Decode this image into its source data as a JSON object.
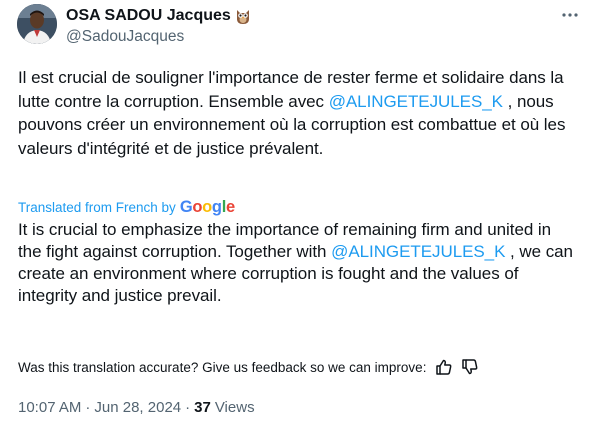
{
  "author": {
    "display_name": "OSA SADOU Jacques",
    "handle": "@SadouJacques",
    "badge_icon": "owl-emoji-icon"
  },
  "tweet": {
    "original": {
      "part1": "Il est crucial de souligner l'importance de rester ferme et solidaire dans la lutte contre la corruption. Ensemble avec ",
      "mention": "@ALINGETEJULES_K",
      "part2": " , nous pouvons créer un environnement où la corruption est combattue et où les valeurs d'intégrité et de justice prévalent."
    },
    "translation_label": "Translated from French by",
    "translation_provider": {
      "letters": [
        "G",
        "o",
        "o",
        "g",
        "l",
        "e"
      ],
      "colors": [
        "#4285f4",
        "#ea4335",
        "#fbbc05",
        "#4285f4",
        "#34a853",
        "#ea4335"
      ]
    },
    "translation": {
      "part1": "It is crucial to emphasize the importance of remaining firm and united in the fight against corruption. Together with ",
      "mention": "@ALINGETEJULES_K",
      "part2": " , we can create an environment where corruption is fought and the values of integrity and justice prevail."
    },
    "feedback_prompt": "Was this translation accurate? Give us feedback so we can improve:",
    "time": "10:07 AM",
    "separator": "·",
    "date": "Jun 28, 2024",
    "views_count": "37",
    "views_label": "Views"
  },
  "colors": {
    "link": "#1d9bf0",
    "secondary_text": "#536471",
    "primary_text": "#0f1419"
  }
}
